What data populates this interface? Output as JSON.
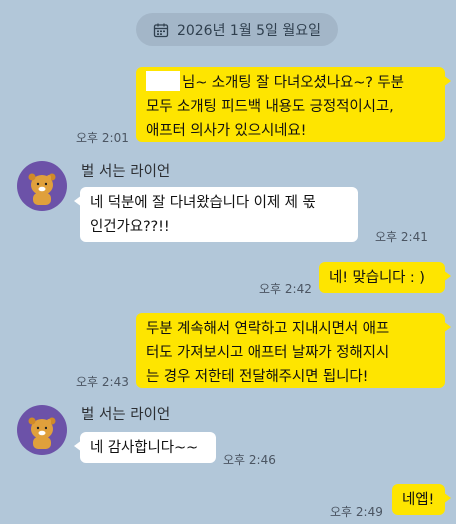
{
  "date_divider": {
    "icon": "calendar-icon",
    "text": "2026년 1월 5일 월요일"
  },
  "colors": {
    "background": "#b2c7d9",
    "my_bubble": "#fee500",
    "their_bubble": "#ffffff",
    "avatar_bg": "#6c52a8"
  },
  "messages": [
    {
      "id": "m1",
      "from": "me",
      "text": "님~ 소개팅 잘 다녀오셨나요~? 두분\n모두 소개팅 피드백 내용도 긍정적이시고,\n애프터 의사가 있으시네요!",
      "redacted_prefix": true,
      "time": "오후 2:01"
    },
    {
      "id": "m2",
      "from": "other",
      "sender": "벌 서는 라이언",
      "avatar": "lion-character-avatar",
      "text": "네 덕분에 잘 다녀왔습니다 이제 제 몫\n인건가요??!!",
      "time": "오후 2:41"
    },
    {
      "id": "m3",
      "from": "me",
      "text": "네! 맞습니다 : )",
      "time": "오후 2:42"
    },
    {
      "id": "m4",
      "from": "me",
      "text": "두분 계속해서 연락하고 지내시면서 애프\n터도 가져보시고 애프터 날짜가 정해지시\n는 경우 저한테 전달해주시면 됩니다!",
      "time": "오후 2:43"
    },
    {
      "id": "m5",
      "from": "other",
      "sender": "벌 서는 라이언",
      "avatar": "lion-character-avatar",
      "text": "네 감사합니다~~",
      "time": "오후 2:46"
    },
    {
      "id": "m6",
      "from": "me",
      "text": "네엡!",
      "time": "오후 2:49"
    }
  ]
}
